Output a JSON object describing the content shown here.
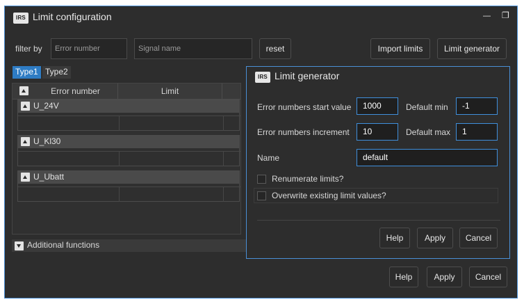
{
  "window": {
    "logo_text": "IRS",
    "title": "Limit configuration",
    "minimize_glyph": "—",
    "maximize_glyph": "❐"
  },
  "filter": {
    "label": "filter by",
    "error_number_placeholder": "Error number",
    "signal_name_placeholder": "Signal name",
    "reset_label": "reset",
    "import_label": "Import limits",
    "generator_label": "Limit generator"
  },
  "tabs": [
    {
      "label": "Type1",
      "active": true
    },
    {
      "label": "Type2",
      "active": false
    }
  ],
  "table": {
    "columns": [
      "Error number",
      "Limit"
    ],
    "groups": [
      {
        "name": "U_24V"
      },
      {
        "name": "U_Kl30"
      },
      {
        "name": "U_Ubatt"
      }
    ]
  },
  "additional_functions": "Additional functions",
  "footer": {
    "help": "Help",
    "apply": "Apply",
    "cancel": "Cancel"
  },
  "dialog": {
    "logo_text": "IRS",
    "title": "Limit generator",
    "start_label": "Error numbers start value",
    "start_value": "1000",
    "increment_label": "Error numbers increment",
    "increment_value": "10",
    "default_min_label": "Default min",
    "default_min_value": "-1",
    "default_max_label": "Default max",
    "default_max_value": "1",
    "name_label": "Name",
    "name_value": "default",
    "renumerate_label": "Renumerate limits?",
    "overwrite_label": "Overwrite existing limit values?",
    "help": "Help",
    "apply": "Apply",
    "cancel": "Cancel"
  },
  "colors": {
    "accent": "#4a8fd6",
    "active_tab": "#2e7cc4",
    "background": "#2d2d2d"
  }
}
